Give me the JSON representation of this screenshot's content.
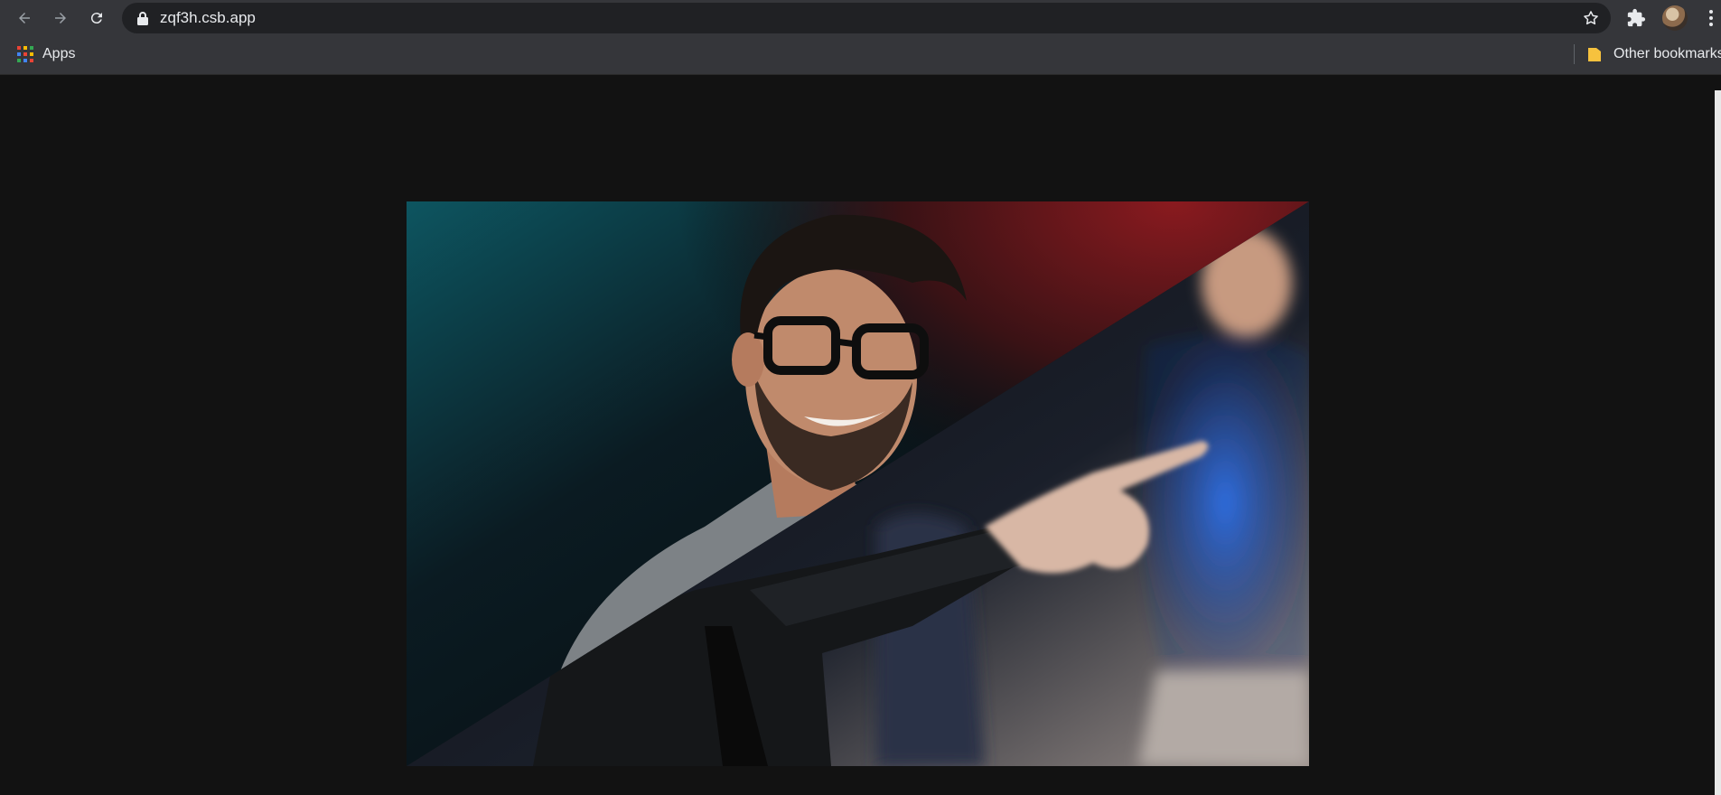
{
  "browser": {
    "url": "zqf3h.csb.app",
    "icons": {
      "back": "arrow-left-icon",
      "forward": "arrow-right-icon",
      "reload": "reload-icon",
      "lock": "lock-icon",
      "star": "star-icon",
      "extensions": "puzzle-icon",
      "menu": "more-vert-icon"
    }
  },
  "bookmarks": {
    "apps_label": "Apps",
    "other_label": "Other bookmarks"
  },
  "colors": {
    "page_background": "#121212",
    "chrome": "#35363a",
    "omnibox": "#202124"
  },
  "hero": {
    "description_alt": "Split diagonal photo of a smiling man with glasses and a man pointing"
  }
}
